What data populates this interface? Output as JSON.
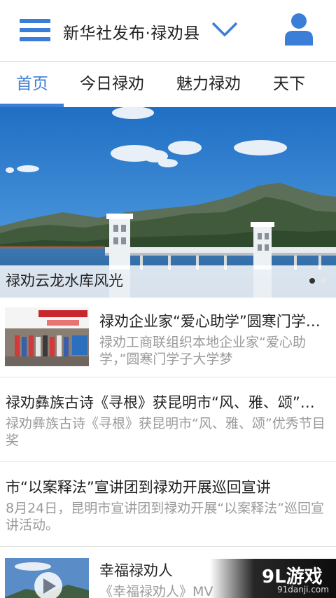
{
  "header": {
    "title": "新华社发布·禄劝县"
  },
  "tabs": [
    {
      "label": "首页",
      "active": true
    },
    {
      "label": "今日禄劝",
      "active": false
    },
    {
      "label": "魅力禄劝",
      "active": false
    },
    {
      "label": "天下",
      "active": false
    }
  ],
  "banner": {
    "caption": "禄劝云龙水库风光",
    "slides": 2,
    "current_slide": 1
  },
  "news": [
    {
      "title": "禄劝企业家“爱心助学”圆寒门学子大学梦",
      "summary": "禄劝工商联组织本地企业家“爱心助学，”圆寒门学子大学梦",
      "has_thumbnail": true
    },
    {
      "title": "禄劝彝族古诗《寻根》获昆明市“风、雅、颂”优秀节目奖",
      "summary": "禄劝彝族古诗《寻根》获昆明市“风、雅、颂”优秀节目奖",
      "has_thumbnail": false
    },
    {
      "title": "市“以案释法”宣讲团到禄劝开展巡回宣讲",
      "summary": "8月24日，昆明市宣讲团到禄劝开展“以案释法”巡回宣讲活动。",
      "has_thumbnail": false
    },
    {
      "title": "幸福禄劝人",
      "summary": "《幸福禄劝人》MV",
      "has_thumbnail": true,
      "is_video": true
    }
  ],
  "watermark": {
    "brand": "9L游戏",
    "url": "91danji.com"
  },
  "colors": {
    "accent": "#3b7ed8",
    "summary_text": "#9a9a9a",
    "divider": "#e2e2e2"
  },
  "icons": {
    "menu": "hamburger-menu-icon",
    "dropdown": "chevron-down-icon",
    "user": "user-profile-icon",
    "play": "play-icon"
  }
}
